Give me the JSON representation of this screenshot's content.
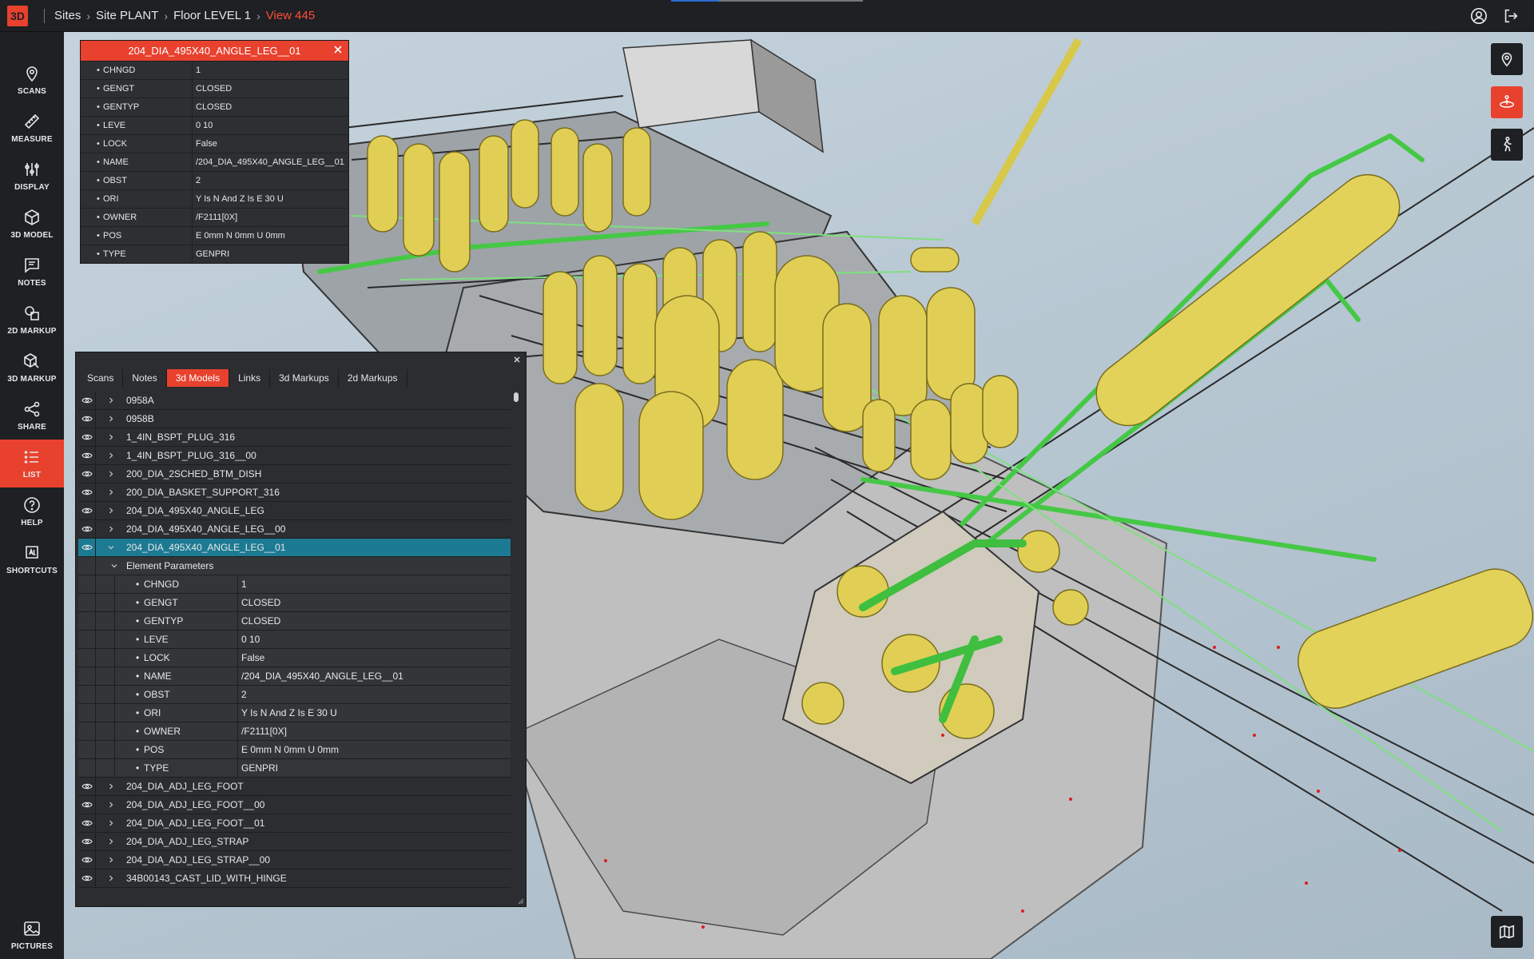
{
  "app": {
    "logo": "3D"
  },
  "breadcrumb": [
    {
      "label": "Sites",
      "current": false
    },
    {
      "label": "Site PLANT",
      "current": false
    },
    {
      "label": "Floor LEVEL 1",
      "current": false
    },
    {
      "label": "View 445",
      "current": true
    }
  ],
  "top_progress": 0.25,
  "top_icons": [
    "account-icon",
    "logout-icon"
  ],
  "sidebar": {
    "items": [
      {
        "label": "SCANS",
        "icon": "map-pin-icon",
        "active": false
      },
      {
        "label": "MEASURE",
        "icon": "ruler-icon",
        "active": false
      },
      {
        "label": "DISPLAY",
        "icon": "sliders-icon",
        "active": false
      },
      {
        "label": "3D MODEL",
        "icon": "cube-icon",
        "active": false
      },
      {
        "label": "NOTES",
        "icon": "note-icon",
        "active": false
      },
      {
        "label": "2D MARKUP",
        "icon": "shapes-icon",
        "active": false
      },
      {
        "label": "3D MARKUP",
        "icon": "cube-markup-icon",
        "active": false
      },
      {
        "label": "SHARE",
        "icon": "share-icon",
        "active": false
      },
      {
        "label": "LIST",
        "icon": "list-icon",
        "active": true
      },
      {
        "label": "HELP",
        "icon": "help-icon",
        "active": false
      },
      {
        "label": "SHORTCUTS",
        "icon": "keyboard-icon",
        "active": false
      }
    ],
    "bottom": {
      "label": "PICTURES",
      "icon": "image-icon"
    }
  },
  "right_tools": [
    {
      "icon": "location-pin-icon",
      "active": false
    },
    {
      "icon": "orbit-person-icon",
      "active": true
    },
    {
      "icon": "walk-icon",
      "active": false
    }
  ],
  "popup": {
    "title": "204_DIA_495X40_ANGLE_LEG__01",
    "rows": [
      {
        "key": "CHNGD",
        "value": "1"
      },
      {
        "key": "GENGT",
        "value": "CLOSED"
      },
      {
        "key": "GENTYP",
        "value": "CLOSED"
      },
      {
        "key": "LEVE",
        "value": "0 10"
      },
      {
        "key": "LOCK",
        "value": "False"
      },
      {
        "key": "NAME",
        "value": "/204_DIA_495X40_ANGLE_LEG__01"
      },
      {
        "key": "OBST",
        "value": "2"
      },
      {
        "key": "ORI",
        "value": "Y Is N And Z Is E 30 U"
      },
      {
        "key": "OWNER",
        "value": "/F2111[0X]"
      },
      {
        "key": "POS",
        "value": "E 0mm N 0mm U 0mm"
      },
      {
        "key": "TYPE",
        "value": "GENPRI"
      }
    ]
  },
  "panel": {
    "tabs": [
      {
        "label": "Scans",
        "active": false
      },
      {
        "label": "Notes",
        "active": false
      },
      {
        "label": "3d Models",
        "active": true
      },
      {
        "label": "Links",
        "active": false
      },
      {
        "label": "3d Markups",
        "active": false
      },
      {
        "label": "2d Markups",
        "active": false
      }
    ],
    "items_before": [
      "0958A",
      "0958B",
      "1_4IN_BSPT_PLUG_316",
      "1_4IN_BSPT_PLUG_316__00",
      "200_DIA_2SCHED_BTM_DISH",
      "200_DIA_BASKET_SUPPORT_316",
      "204_DIA_495X40_ANGLE_LEG",
      "204_DIA_495X40_ANGLE_LEG__00"
    ],
    "selected_item": "204_DIA_495X40_ANGLE_LEG__01",
    "subsection_label": "Element Parameters",
    "parameters": [
      {
        "key": "CHNGD",
        "value": "1"
      },
      {
        "key": "GENGT",
        "value": "CLOSED"
      },
      {
        "key": "GENTYP",
        "value": "CLOSED"
      },
      {
        "key": "LEVE",
        "value": "0 10"
      },
      {
        "key": "LOCK",
        "value": "False"
      },
      {
        "key": "NAME",
        "value": "/204_DIA_495X40_ANGLE_LEG__01"
      },
      {
        "key": "OBST",
        "value": "2"
      },
      {
        "key": "ORI",
        "value": "Y Is N And Z Is E 30 U"
      },
      {
        "key": "OWNER",
        "value": "/F2111[0X]"
      },
      {
        "key": "POS",
        "value": "E 0mm N 0mm U 0mm"
      },
      {
        "key": "TYPE",
        "value": "GENPRI"
      }
    ],
    "items_after": [
      "204_DIA_ADJ_LEG_FOOT",
      "204_DIA_ADJ_LEG_FOOT__00",
      "204_DIA_ADJ_LEG_FOOT__01",
      "204_DIA_ADJ_LEG_STRAP",
      "204_DIA_ADJ_LEG_STRAP__00",
      "34B00143_CAST_LID_WITH_HINGE"
    ]
  },
  "map_button": {
    "icon": "map-icon"
  },
  "colors": {
    "accent": "#e8412e",
    "selected_row": "#1d7a93",
    "vessel": "#e2d25a",
    "pipe": "#4bd04b",
    "steel": "#8c9197"
  }
}
